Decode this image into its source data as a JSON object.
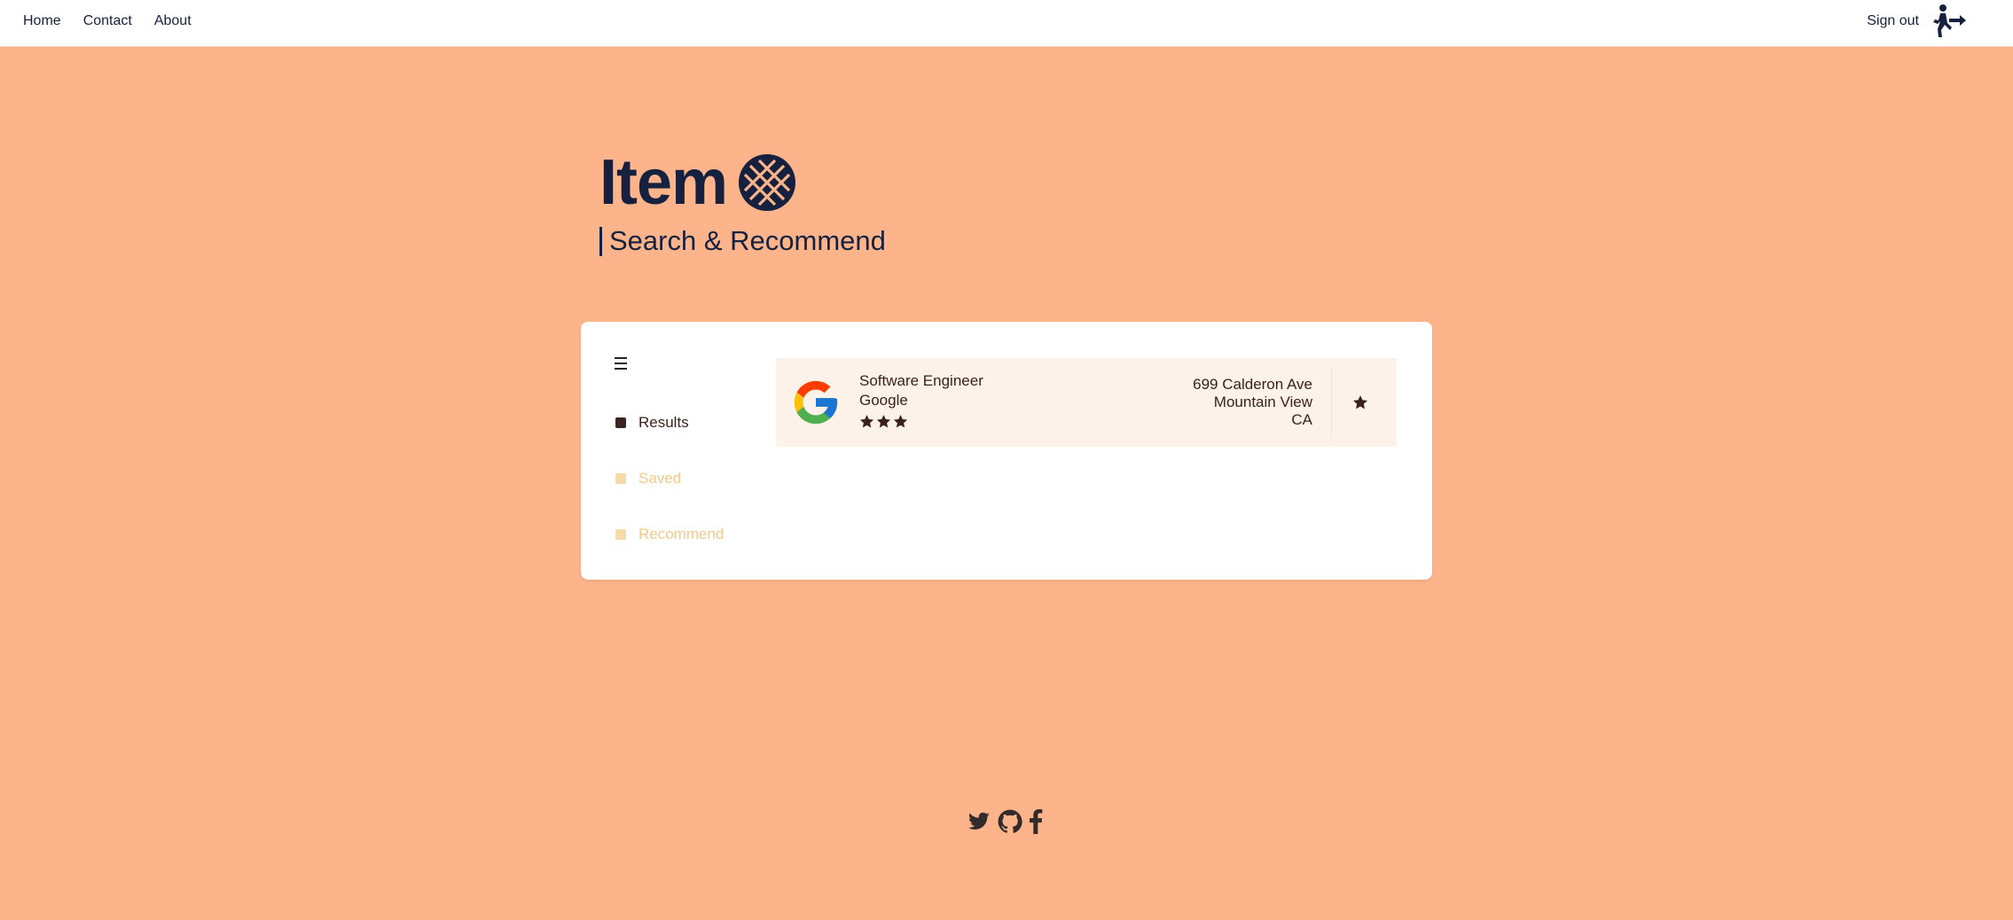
{
  "nav": {
    "home": "Home",
    "contact": "Contact",
    "about": "About",
    "sign_out": "Sign out"
  },
  "hero": {
    "title": "Item",
    "subtitle": "Search & Recommend"
  },
  "sidebar": {
    "items": [
      {
        "label": "Results",
        "active": true
      },
      {
        "label": "Saved",
        "active": false
      },
      {
        "label": "Recommend",
        "active": false
      }
    ]
  },
  "results": [
    {
      "title": "Software Engineer",
      "company": "Google",
      "rating": 3,
      "address": [
        "699 Calderon Ave",
        "Mountain View",
        "CA"
      ],
      "logo": "google-logo"
    }
  ],
  "icons": {
    "menu": "hamburger-menu-icon",
    "sign_out": "walking-exit-icon",
    "save": "star-icon",
    "footer": [
      "twitter-icon",
      "github-icon",
      "facebook-icon"
    ]
  },
  "colors": {
    "background": "#fdb48b",
    "navy": "#16213f",
    "brown": "#3b1f19",
    "inactive": "#f2c98a",
    "result_bg": "#fcf2ea"
  }
}
